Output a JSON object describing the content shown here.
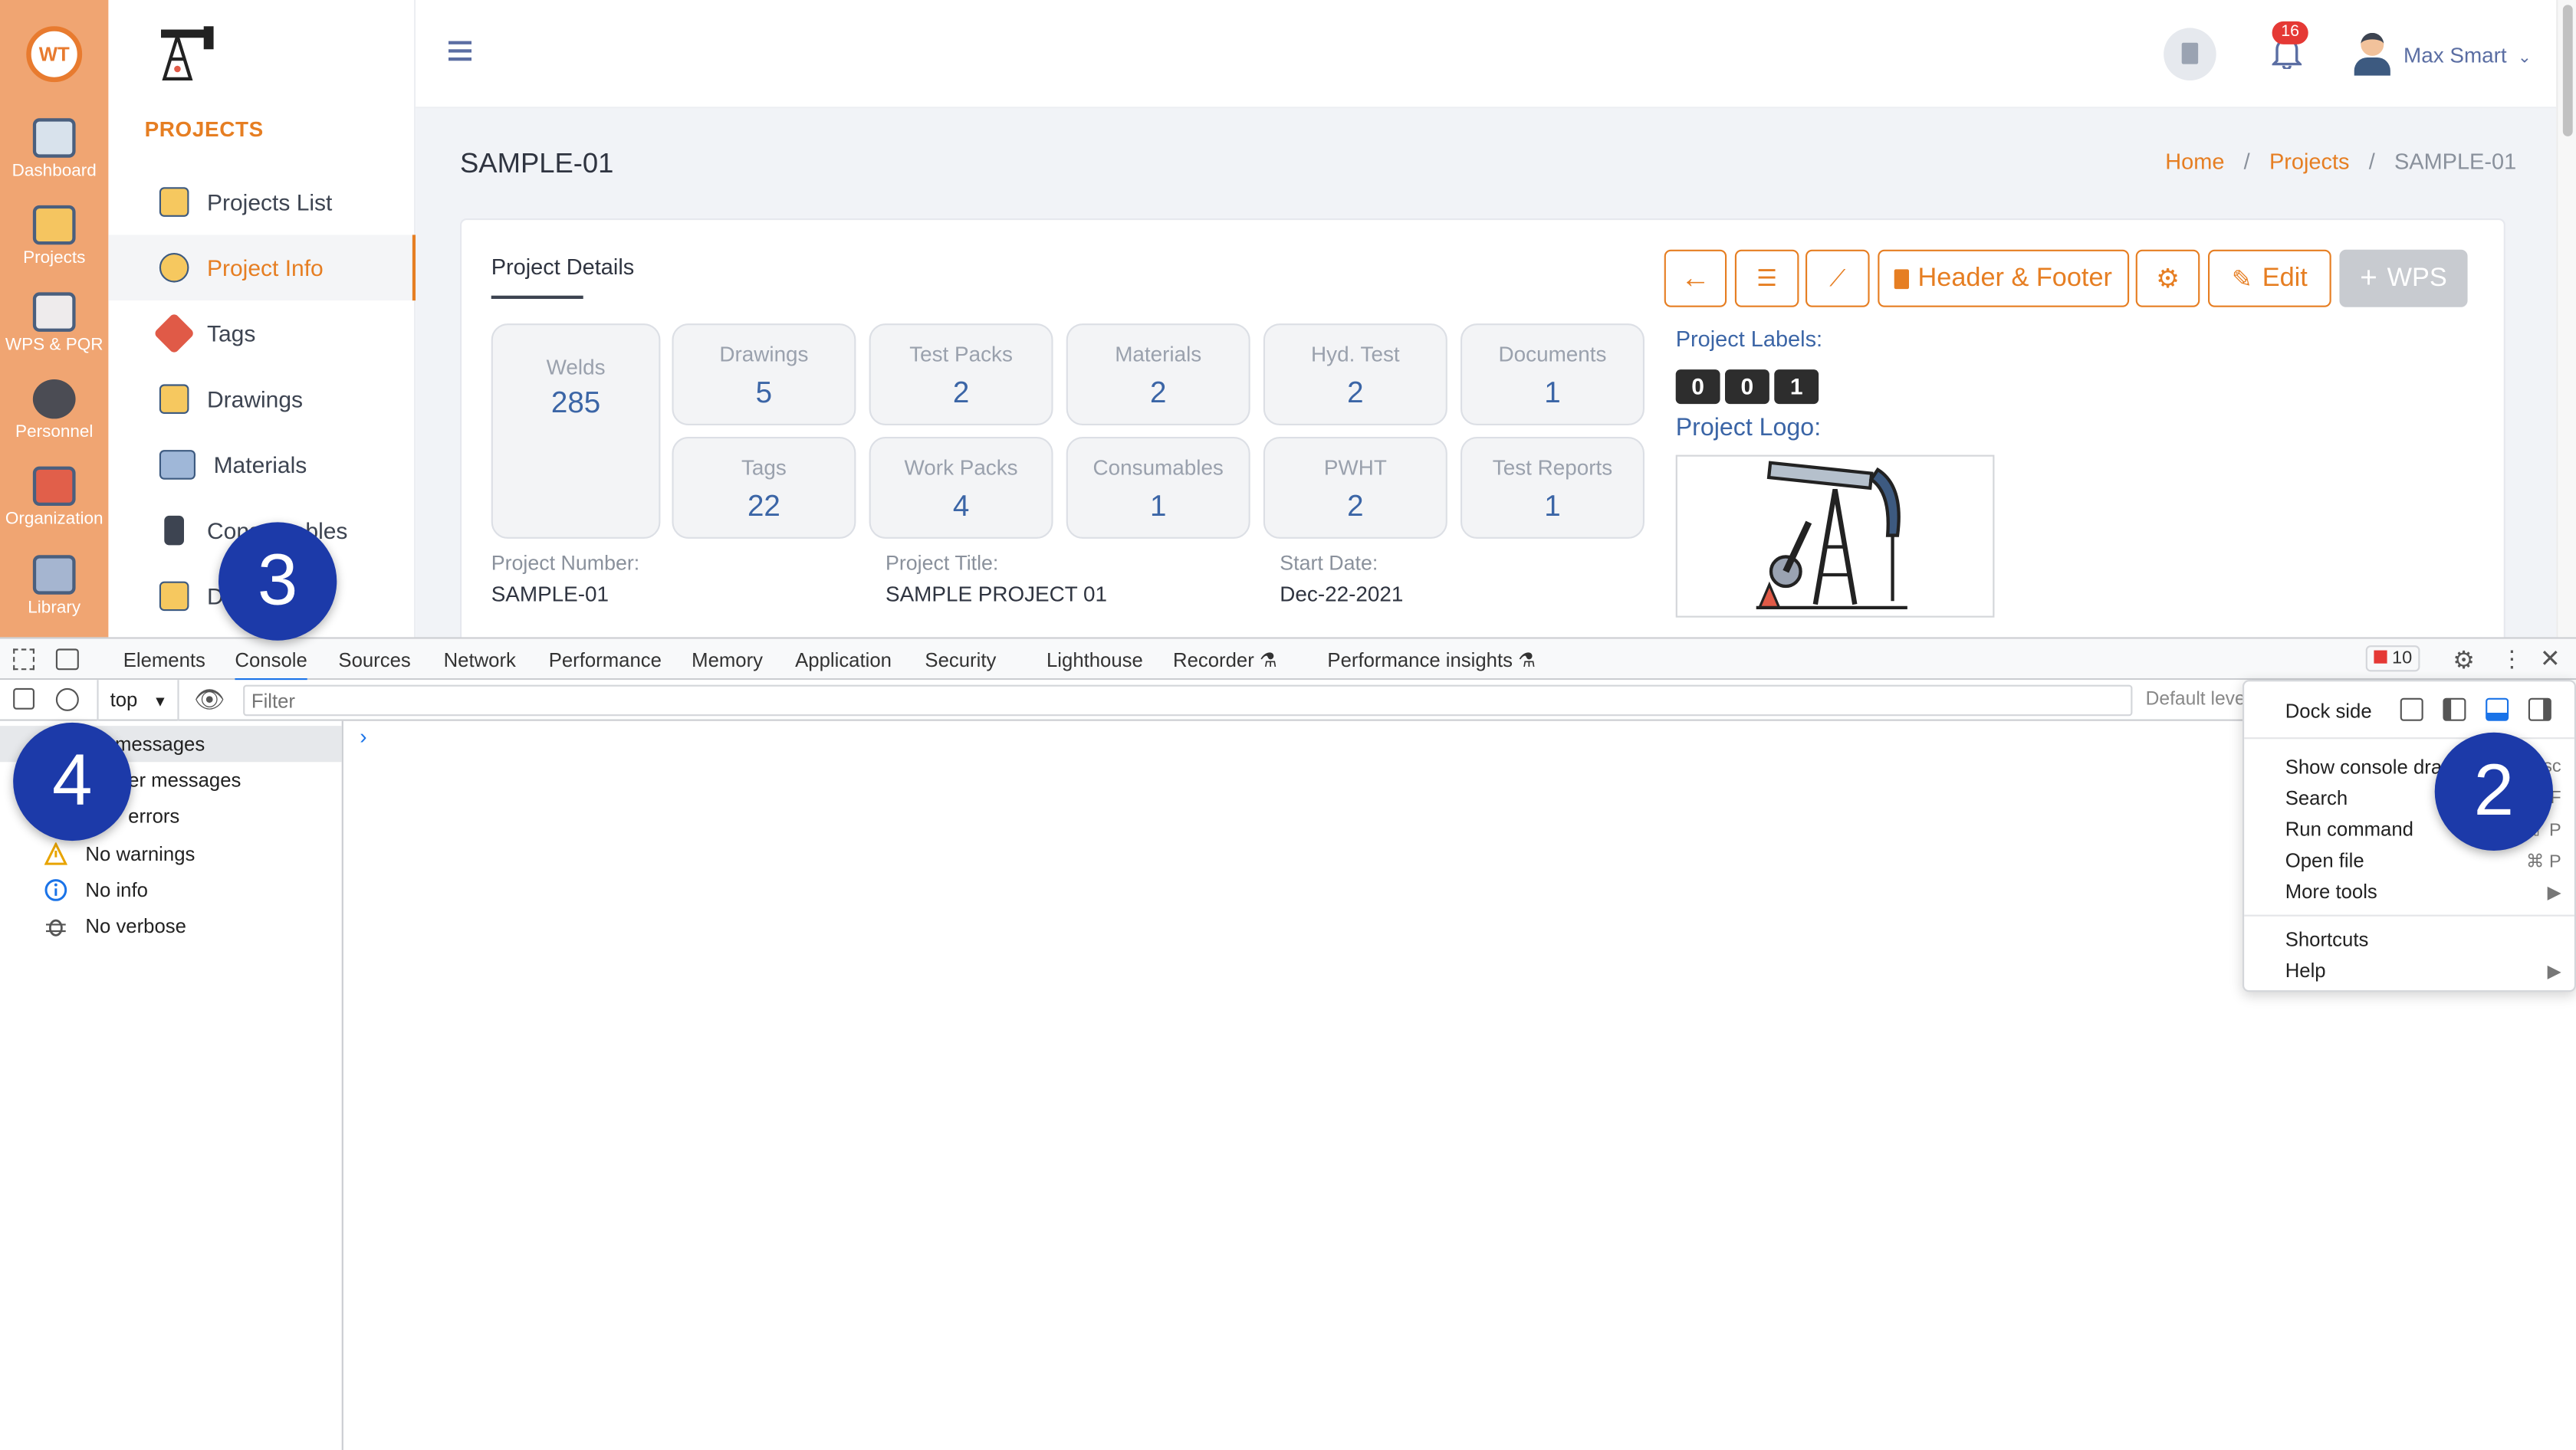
{
  "rail": {
    "items": [
      {
        "label": "Dashboard"
      },
      {
        "label": "Projects"
      },
      {
        "label": "WPS & PQR"
      },
      {
        "label": "Personnel"
      },
      {
        "label": "Organization"
      },
      {
        "label": "Library"
      }
    ]
  },
  "subnav": {
    "section": "PROJECTS",
    "items": [
      {
        "label": "Projects List"
      },
      {
        "label": "Project Info"
      },
      {
        "label": "Tags"
      },
      {
        "label": "Drawings"
      },
      {
        "label": "Materials"
      },
      {
        "label": "Consumables"
      },
      {
        "label": "D"
      }
    ]
  },
  "topbar": {
    "notifications": "16",
    "user": "Max Smart"
  },
  "page": {
    "title": "SAMPLE-01",
    "breadcrumb": {
      "home": "Home",
      "projects": "Projects",
      "current": "SAMPLE-01"
    }
  },
  "card": {
    "tab": "Project Details",
    "welds_label": "Welds",
    "welds_value": "285",
    "stats": [
      {
        "label": "Drawings",
        "value": "5"
      },
      {
        "label": "Test Packs",
        "value": "2"
      },
      {
        "label": "Materials",
        "value": "2"
      },
      {
        "label": "Hyd. Test",
        "value": "2"
      },
      {
        "label": "Documents",
        "value": "1"
      },
      {
        "label": "Tags",
        "value": "22"
      },
      {
        "label": "Work Packs",
        "value": "4"
      },
      {
        "label": "Consumables",
        "value": "1"
      },
      {
        "label": "PWHT",
        "value": "2"
      },
      {
        "label": "Test Reports",
        "value": "1"
      }
    ],
    "project_number_label": "Project Number:",
    "project_number": "SAMPLE-01",
    "project_title_label": "Project Title:",
    "project_title": "SAMPLE PROJECT 01",
    "start_date_label": "Start Date:",
    "start_date": "Dec-22-2021",
    "labels_label": "Project Labels:",
    "labels": [
      "0",
      "0",
      "1"
    ],
    "logo_label": "Project Logo:",
    "buttons": {
      "header_footer": "Header & Footer",
      "edit": "Edit",
      "wps": "WPS"
    }
  },
  "devtools": {
    "tabs": [
      "Elements",
      "Console",
      "Sources",
      "Network",
      "Performance",
      "Memory",
      "Application",
      "Security",
      "Lighthouse",
      "Recorder",
      "Performance insights"
    ],
    "error_count": "10",
    "context": "top",
    "filter_placeholder": "Filter",
    "default_levels": "Default leve",
    "side": [
      {
        "label": "messages"
      },
      {
        "label": "er messages"
      },
      {
        "label": "errors"
      },
      {
        "label": "No warnings"
      },
      {
        "label": "No info"
      },
      {
        "label": "No verbose"
      }
    ],
    "menu": {
      "dock_side": "Dock side",
      "items": [
        {
          "label": "Show console draw",
          "key": "sc"
        },
        {
          "label": "Search",
          "key": "F"
        },
        {
          "label": "Run command",
          "key": "⇧ P"
        },
        {
          "label": "Open file",
          "key": "⌘ P"
        },
        {
          "label": "More tools",
          "key": "▶"
        },
        {
          "label": "Shortcuts",
          "key": ""
        },
        {
          "label": "Help",
          "key": "▶"
        }
      ]
    }
  },
  "callouts": {
    "c2": "2",
    "c3": "3",
    "c4": "4"
  }
}
